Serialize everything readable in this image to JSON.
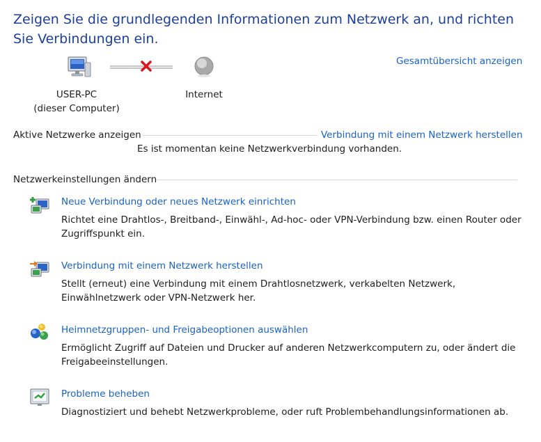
{
  "header": {
    "title": "Zeigen Sie die grundlegenden Informationen zum Netzwerk an, und richten Sie Verbindungen ein.",
    "overview_link": "Gesamtübersicht anzeigen"
  },
  "network_map": {
    "computer_name": "USER-PC",
    "computer_sub": "(dieser Computer)",
    "internet_label": "Internet"
  },
  "active_networks": {
    "heading": "Aktive Netzwerke anzeigen",
    "connect_link": "Verbindung mit einem Netzwerk herstellen",
    "status": "Es ist momentan keine Netzwerkverbindung vorhanden."
  },
  "settings": {
    "heading": "Netzwerkeinstellungen ändern",
    "items": [
      {
        "icon": "new-connection-icon",
        "title": "Neue Verbindung oder neues Netzwerk einrichten",
        "desc_line1": "Richtet eine Drahtlos-, Breitband-, Einwähl-, Ad-hoc- oder VPN-Verbindung bzw. einen Router oder",
        "desc_line2": "Zugriffspunkt ein."
      },
      {
        "icon": "connect-network-icon",
        "title": "Verbindung mit einem Netzwerk herstellen",
        "desc_line1": "Stellt (erneut) eine Verbindung mit einem Drahtlosnetzwerk, verkabelten Netzwerk,",
        "desc_line2": "Einwählnetzwerk oder VPN-Netzwerk her."
      },
      {
        "icon": "homegroup-icon",
        "title": "Heimnetzgruppen- und Freigabeoptionen auswählen",
        "desc_line1": "Ermöglicht Zugriff auf Dateien und Drucker auf anderen Netzwerkcomputern zu, oder ändert die",
        "desc_line2": "Freigabeeinstellungen."
      },
      {
        "icon": "troubleshoot-icon",
        "title": "Probleme beheben",
        "desc_line1": "Diagnostiziert und behebt Netzwerkprobleme, oder ruft Problembehandlungsinformationen ab.",
        "desc_line2": ""
      }
    ]
  },
  "colors": {
    "title": "#1e3f9b",
    "link": "#1a62c4",
    "error": "#d8171c"
  }
}
